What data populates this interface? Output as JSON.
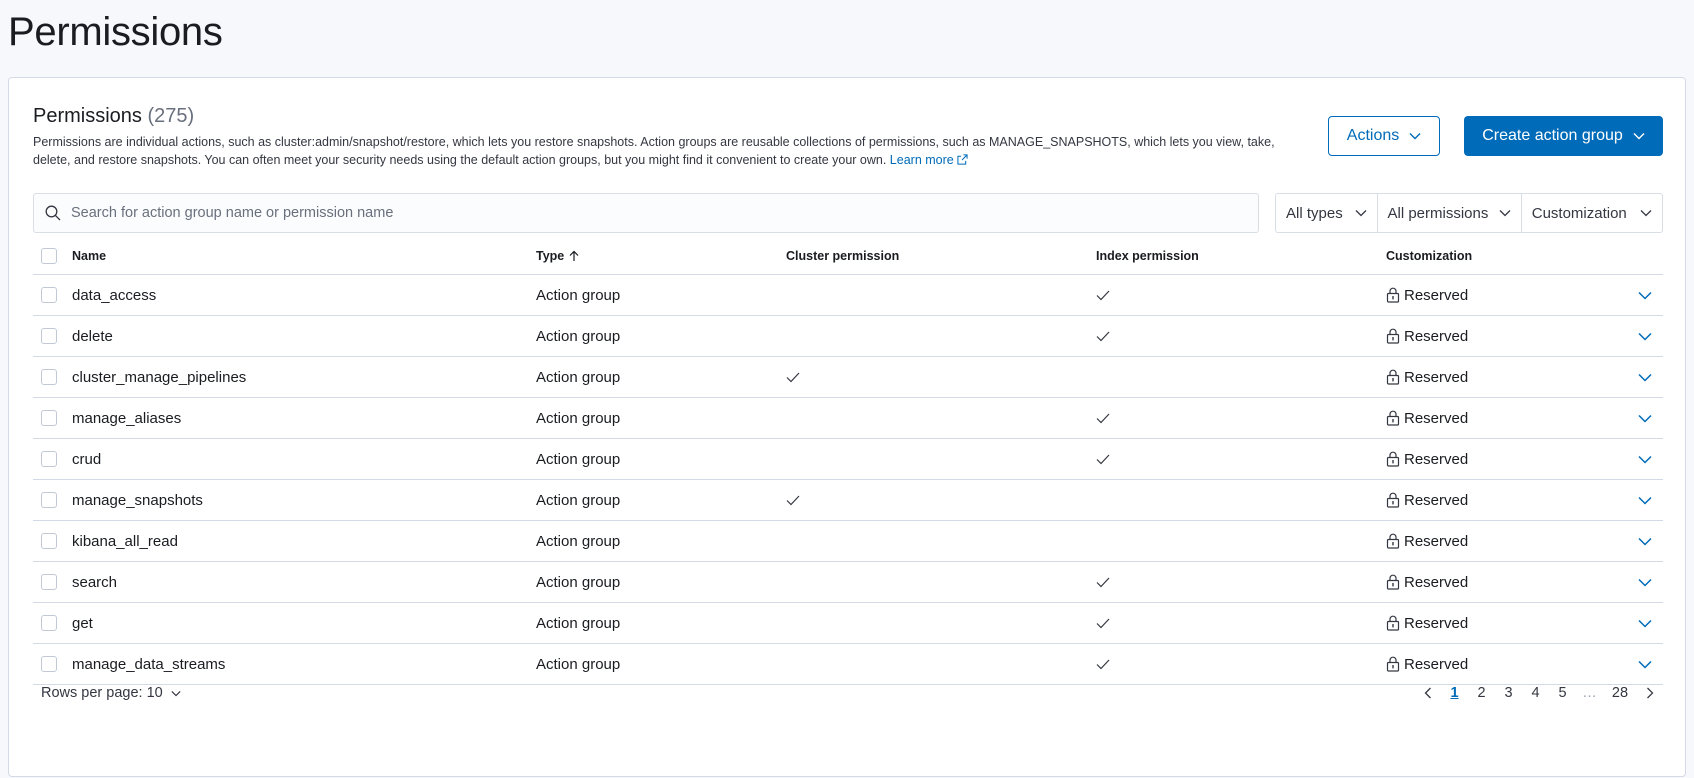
{
  "page": {
    "title": "Permissions"
  },
  "panel": {
    "title": "Permissions",
    "count": "(275)",
    "description": "Permissions are individual actions, such as cluster:admin/snapshot/restore, which lets you restore snapshots. Action groups are reusable collections of permissions, such as MANAGE_SNAPSHOTS, which lets you view, take, delete, and restore snapshots. You can often meet your security needs using the default action groups, but you might find it convenient to create your own.",
    "learn_more": "Learn more",
    "actions_label": "Actions",
    "create_label": "Create action group"
  },
  "search": {
    "placeholder": "Search for action group name or permission name"
  },
  "filters": {
    "type": "All types",
    "permissions": "All permissions",
    "customization": "Customization"
  },
  "table": {
    "columns": {
      "name": "Name",
      "type": "Type",
      "cluster": "Cluster permission",
      "index": "Index permission",
      "customization": "Customization"
    },
    "rows": [
      {
        "name": "data_access",
        "type": "Action group",
        "cluster": false,
        "index": true,
        "customization": "Reserved"
      },
      {
        "name": "delete",
        "type": "Action group",
        "cluster": false,
        "index": true,
        "customization": "Reserved"
      },
      {
        "name": "cluster_manage_pipelines",
        "type": "Action group",
        "cluster": true,
        "index": false,
        "customization": "Reserved"
      },
      {
        "name": "manage_aliases",
        "type": "Action group",
        "cluster": false,
        "index": true,
        "customization": "Reserved"
      },
      {
        "name": "crud",
        "type": "Action group",
        "cluster": false,
        "index": true,
        "customization": "Reserved"
      },
      {
        "name": "manage_snapshots",
        "type": "Action group",
        "cluster": true,
        "index": false,
        "customization": "Reserved"
      },
      {
        "name": "kibana_all_read",
        "type": "Action group",
        "cluster": false,
        "index": false,
        "customization": "Reserved"
      },
      {
        "name": "search",
        "type": "Action group",
        "cluster": false,
        "index": true,
        "customization": "Reserved"
      },
      {
        "name": "get",
        "type": "Action group",
        "cluster": false,
        "index": true,
        "customization": "Reserved"
      },
      {
        "name": "manage_data_streams",
        "type": "Action group",
        "cluster": false,
        "index": true,
        "customization": "Reserved"
      }
    ]
  },
  "footer": {
    "rows_per_page": "Rows per page: 10",
    "pages": [
      "1",
      "2",
      "3",
      "4",
      "5"
    ],
    "ellipsis": "…",
    "last_page": "28",
    "active_page": "1"
  },
  "colors": {
    "primary": "#006bb8",
    "border": "#d3dae6",
    "text": "#1a1c21"
  }
}
